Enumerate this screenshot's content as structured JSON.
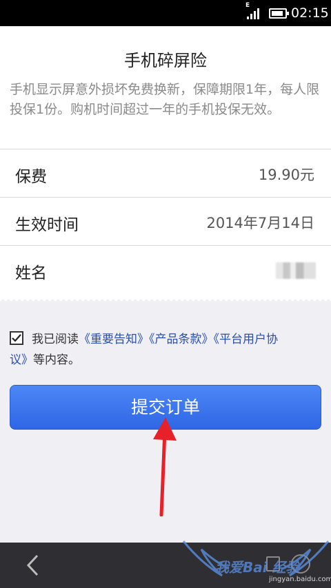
{
  "status_bar": {
    "network_label": "E",
    "time": "02:15"
  },
  "card": {
    "title": "手机碎屏险",
    "description": "手机显示屏意外损坏免费换新，保障期限1年，每人限投保1份。购机时间超过一年的手机投保无效。",
    "rows": [
      {
        "label": "保费",
        "value": "19.90元"
      },
      {
        "label": "生效时间",
        "value": "2014年7月14日"
      },
      {
        "label": "姓名",
        "value": ""
      }
    ]
  },
  "agreement": {
    "checked": true,
    "prefix": "我已阅读",
    "link1": "《重要告知》",
    "link2": "《产品条款》",
    "link3_part1": "《平台用户协",
    "link3_part2": "议》",
    "suffix": "等内容。"
  },
  "submit": {
    "label": "提交订单"
  },
  "watermark": {
    "text": "我爱Bai 经验",
    "url": "jingyan.baidu.com"
  },
  "colors": {
    "accent": "#3a72ee",
    "link": "#2a4fb0",
    "arrow": "#e8202a"
  }
}
